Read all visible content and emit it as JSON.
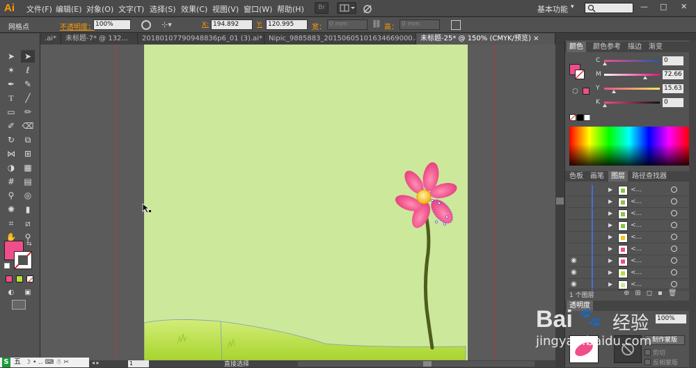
{
  "app": {
    "logo": "Ai"
  },
  "menubar": {
    "items": [
      "文件(F)",
      "编辑(E)",
      "对象(O)",
      "文字(T)",
      "选择(S)",
      "效果(C)",
      "视图(V)",
      "窗口(W)",
      "帮助(H)"
    ],
    "workspace": "基本功能",
    "workspace_caret": "▾",
    "bridge_label": "Br",
    "window_controls": [
      "—",
      "□",
      "✕"
    ]
  },
  "controlbar": {
    "selection_label": "网格点",
    "opacity_label": "不透明度：",
    "opacity_value": "100%",
    "x_label": "X:",
    "x_value": "194.892",
    "y_label": "Y:",
    "y_value": "120.995",
    "width_label": "宽：",
    "width_value": "0 mm",
    "height_label": "高：",
    "height_value": "0 mm"
  },
  "tabs": [
    {
      "label": ".ai*",
      "active": false
    },
    {
      "label": "未标题-7* @ 132...",
      "active": false
    },
    {
      "label": "20180107790948836p6_01 (3).ai*",
      "active": false
    },
    {
      "label": "Nipic_9885883_20150605101634669000.ai*",
      "active": false
    },
    {
      "label": "未标题-25* @ 150% (CMYK/预览)",
      "active": true
    }
  ],
  "tab_close": "×",
  "colors": {
    "fill": "#f04e8a",
    "artboard": "#cce89b",
    "grass": "#b6df3e",
    "stem": "#4f5e1c",
    "petal": "#f04e8a",
    "center": "#f7c21a",
    "accent": "#ff9a00"
  },
  "color_panel": {
    "tabs": [
      "颜色",
      "颜色参考",
      "描边",
      "渐变"
    ],
    "channels": [
      {
        "label": "C",
        "value": "0",
        "level": 0.0
      },
      {
        "label": "M",
        "value": "72.66",
        "level": 0.7266
      },
      {
        "label": "Y",
        "value": "15.63",
        "level": 0.1563
      },
      {
        "label": "K",
        "value": "0",
        "level": 0.0
      }
    ]
  },
  "layers_panel": {
    "tabs": [
      "色板",
      "画笔",
      "图层",
      "路径查找器"
    ],
    "rows": [
      "<...",
      "<...",
      "<...",
      "<...",
      "<...",
      "<...",
      "<...",
      "<...",
      "<..."
    ],
    "footer_label": "1 个图层"
  },
  "transparency_panel": {
    "tab": "透明度",
    "opacity_value": "100%",
    "make_mask_button": "制作蒙版",
    "clip_label": "剪切",
    "invert_label": "反相蒙版"
  },
  "statusbar": {
    "zoom": "150%",
    "page": "1",
    "tool_name": "直接选择"
  },
  "taskbar": {
    "items": [
      "S",
      "五"
    ]
  },
  "watermark": {
    "brand": "Bai",
    "brand2": "经验",
    "url": "jingyan.baidu.com"
  }
}
